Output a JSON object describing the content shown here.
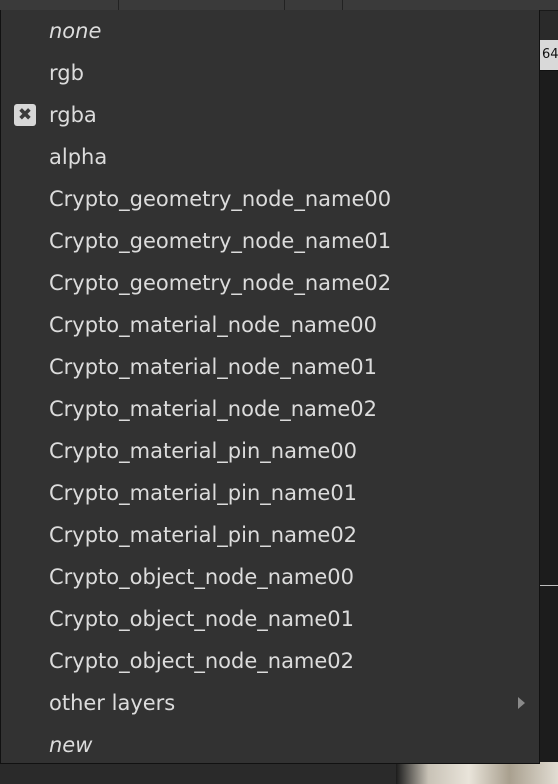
{
  "menu": {
    "items": [
      {
        "label": "none",
        "italic": true,
        "checked": false
      },
      {
        "label": "rgb",
        "italic": false,
        "checked": false
      },
      {
        "label": "rgba",
        "italic": false,
        "checked": true
      },
      {
        "label": "alpha",
        "italic": false,
        "checked": false
      },
      {
        "label": "Crypto_geometry_node_name00",
        "italic": false,
        "checked": false
      },
      {
        "label": "Crypto_geometry_node_name01",
        "italic": false,
        "checked": false
      },
      {
        "label": "Crypto_geometry_node_name02",
        "italic": false,
        "checked": false
      },
      {
        "label": "Crypto_material_node_name00",
        "italic": false,
        "checked": false
      },
      {
        "label": "Crypto_material_node_name01",
        "italic": false,
        "checked": false
      },
      {
        "label": "Crypto_material_node_name02",
        "italic": false,
        "checked": false
      },
      {
        "label": "Crypto_material_pin_name00",
        "italic": false,
        "checked": false
      },
      {
        "label": "Crypto_material_pin_name01",
        "italic": false,
        "checked": false
      },
      {
        "label": "Crypto_material_pin_name02",
        "italic": false,
        "checked": false
      },
      {
        "label": "Crypto_object_node_name00",
        "italic": false,
        "checked": false
      },
      {
        "label": "Crypto_object_node_name01",
        "italic": false,
        "checked": false
      },
      {
        "label": "Crypto_object_node_name02",
        "italic": false,
        "checked": false
      },
      {
        "label": "other layers",
        "italic": false,
        "checked": false,
        "submenu": true
      },
      {
        "label": "new",
        "italic": true,
        "checked": false
      }
    ],
    "check_glyph": "✖",
    "check_icon": "check-x-icon",
    "submenu_icon": "chevron-right-icon"
  },
  "background": {
    "viewer_label": "64"
  },
  "colors": {
    "menu_bg": "#323232",
    "text": "#dcdcdc",
    "check_bg": "#d7d7d7"
  }
}
